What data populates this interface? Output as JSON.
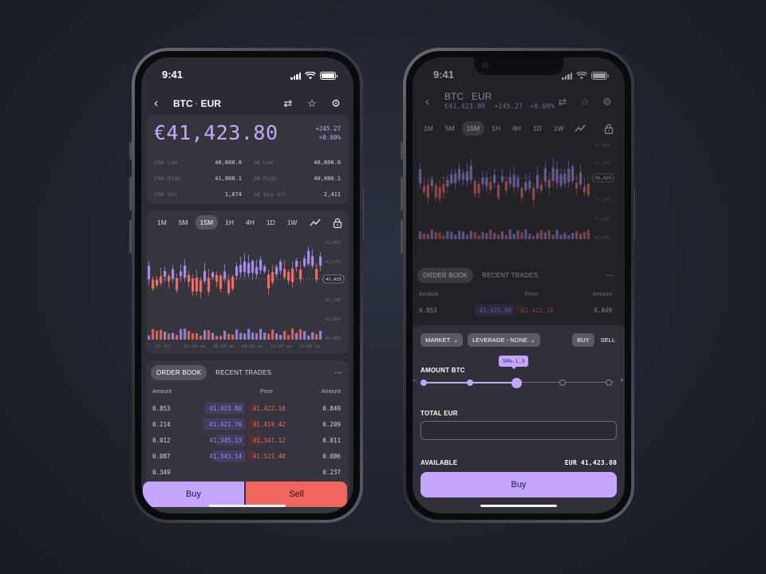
{
  "status": {
    "time": "9:41"
  },
  "pair": {
    "base": "BTC",
    "sep": "·",
    "quote": "EUR"
  },
  "left": {
    "price": "€41,423.80",
    "change_abs": "+245.27",
    "change_pct": "+0.60%",
    "stats": [
      [
        {
          "label": "24H Low",
          "value": "40,800.0"
        },
        {
          "label": "1W Low",
          "value": "40,800.0"
        }
      ],
      [
        {
          "label": "24H High",
          "value": "41,800.1"
        },
        {
          "label": "1W High",
          "value": "40,800.1"
        }
      ],
      [
        {
          "label": "24H Vol",
          "value": "1,874"
        },
        {
          "label": "1W Avg Vol",
          "value": "2,411"
        }
      ]
    ],
    "timeframes": [
      "1M",
      "5M",
      "15M",
      "1H",
      "4H",
      "1D",
      "1W"
    ],
    "active_timeframe": "15M",
    "chart": {
      "y_ticks": [
        "41,800",
        "41,600",
        "41,423",
        "41,200",
        "41,000",
        "40,800"
      ],
      "current": "41,423",
      "x_ticks": [
        "02 Oct",
        "03:00 am",
        "06:00 am",
        "09:00 am",
        "12:00 pm",
        "15:00 pm"
      ]
    },
    "order_book": {
      "tabs": [
        "ORDER BOOK",
        "RECENT TRADES"
      ],
      "active_tab": "ORDER BOOK",
      "more": "···",
      "headers": {
        "amount_left": "Amount",
        "price": "Price",
        "amount_right": "Amount"
      },
      "rows": [
        {
          "bid_amt": "0.853",
          "bid": "41,423.80",
          "ask": "41,422.10",
          "ask_amt": "0.849"
        },
        {
          "bid_amt": "0.214",
          "bid": "41,421.70",
          "ask": "41,419.42",
          "ask_amt": "0.209"
        },
        {
          "bid_amt": "0.012",
          "bid": "41,345.33",
          "ask": "41,341.12",
          "ask_amt": "0.011"
        },
        {
          "bid_amt": "0.087",
          "bid": "41,343.14",
          "ask": "41,523.40",
          "ask_amt": "0.086"
        },
        {
          "bid_amt": "0.349",
          "bid": "",
          "ask": "",
          "ask_amt": "0.237"
        }
      ]
    },
    "buy_label": "Buy",
    "sell_label": "Sell"
  },
  "right": {
    "price_small": "€41,423.80",
    "change_abs": "+245.27",
    "change_pct": "+0.60%",
    "timeframes": [
      "1M",
      "5M",
      "15M",
      "1H",
      "4H",
      "1D",
      "1W"
    ],
    "active_timeframe": "15M",
    "chart": {
      "y_ticks": [
        "41,600",
        "41,400",
        "41,423",
        "41,200",
        "41,000",
        "40,800"
      ],
      "current": "41,423"
    },
    "order_book": {
      "tabs": [
        "ORDER BOOK",
        "RECENT TRADES"
      ],
      "active_tab": "ORDER BOOK",
      "more": "···",
      "headers": {
        "amount_left": "Amount",
        "price": "Price",
        "amount_right": "Amount"
      },
      "rows": [
        {
          "bid_amt": "0.853",
          "bid": "41,423.80",
          "ask": "41,422.10",
          "ask_amt": "0.849"
        }
      ]
    },
    "order_form": {
      "market_label": "MARKET",
      "leverage_label": "LEVERAGE - NONE",
      "side_buy": "BUY",
      "side_sell": "SELL",
      "active_side": "BUY",
      "amount_label": "AMOUNT BTC",
      "slider_tooltip": "50%-1.3",
      "slider_value": 0.5,
      "slider_minus": "−",
      "slider_plus": "+",
      "total_label": "TOTAL EUR",
      "total_value": "",
      "available_label": "AVAILABLE",
      "available_value": "EUR 41,423.80",
      "buy_label": "Buy"
    }
  },
  "colors": {
    "accent": "#c4a6ff",
    "sell": "#f0655d",
    "candle_up": "#a68bea",
    "candle_down": "#ef6b62"
  }
}
